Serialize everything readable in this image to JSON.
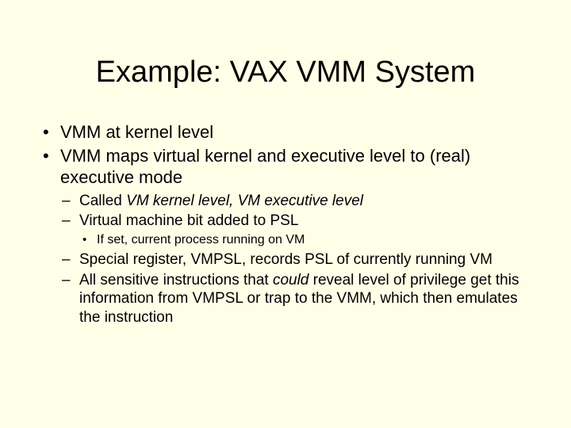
{
  "title": "Example: VAX VMM System",
  "bullets": {
    "b1": "VMM at kernel level",
    "b2": "VMM maps virtual kernel and executive level to (real) executive mode",
    "b2_sub": {
      "s1_pre": "Called ",
      "s1_em": "VM kernel level, VM executive level",
      "s2": "Virtual machine bit added to PSL",
      "s2_sub": {
        "t1": "If set, current process running on VM"
      },
      "s3": "Special register, VMPSL, records PSL of currently running VM",
      "s4_pre": "All sensitive instructions that ",
      "s4_em": "could",
      "s4_post": " reveal level of privilege get this information from VMPSL or trap to the VMM, which then emulates the instruction"
    }
  }
}
